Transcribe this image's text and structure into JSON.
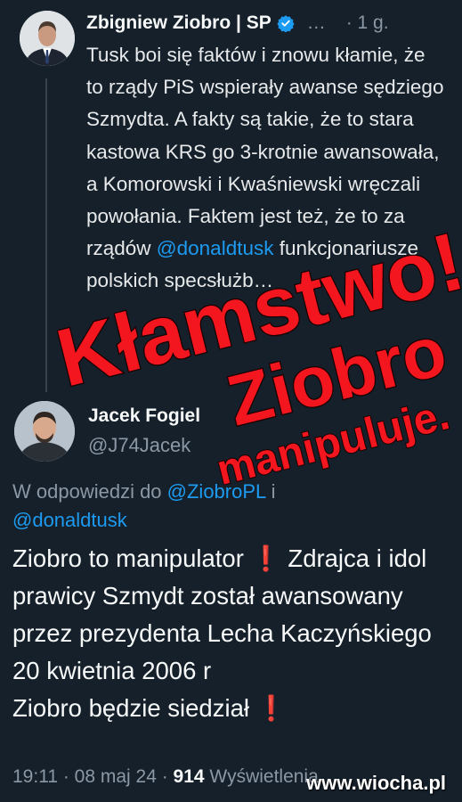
{
  "quoted_tweet": {
    "author_name": "Zbigniew Ziobro | SP",
    "more": "…",
    "time": "· 1 g.",
    "text_before_mention": "Tusk boi się faktów i znowu kłamie, że to rządy PiS wspierały awanse sędziego Szmydta. A fakty są takie, że to stara kastowa KRS go 3-krotnie awansowała, a Komorowski i Kwaśniewski wręczali powołania. Faktem jest też, że to za rządów ",
    "mention": "@donaldtusk",
    "text_after_mention": " funkcjonariusze polskich specsłużb…"
  },
  "reply_tweet": {
    "author_name": "Jacek Fogiel",
    "handle": "@J74Jacek",
    "reply_to_prefix": "W odpowiedzi do ",
    "reply_to_mention_1": "@ZiobroPL",
    "reply_to_connector": " i",
    "reply_to_mention_2": "@donaldtusk",
    "body_line_1_a": "Ziobro to manipulator ",
    "body_line_1_excl": "❗",
    "body_line_1_b": " Zdrajca i idol prawicy Szmydt został awansowany przez prezydenta Lecha Kaczyńskiego 20 kwietnia 2006 r",
    "body_line_2_a": "Ziobro będzie siedział ",
    "body_line_2_excl": "❗",
    "meta_time": "19:11 · 08 maj 24 · ",
    "meta_views": "914",
    "meta_views_label": " Wyświetlenia"
  },
  "overlay": {
    "line1": "Kłamstwo!",
    "line2": "Ziobro",
    "line3": "manipuluje."
  },
  "watermark": {
    "prefix": "www.",
    "brand": "wiocha",
    "suffix": ".pl"
  },
  "colors": {
    "background": "#15202b",
    "mention": "#1d9bf0",
    "muted": "#8b98a5",
    "overlay_red": "#f4161e",
    "verified": "#1d9bf0"
  }
}
